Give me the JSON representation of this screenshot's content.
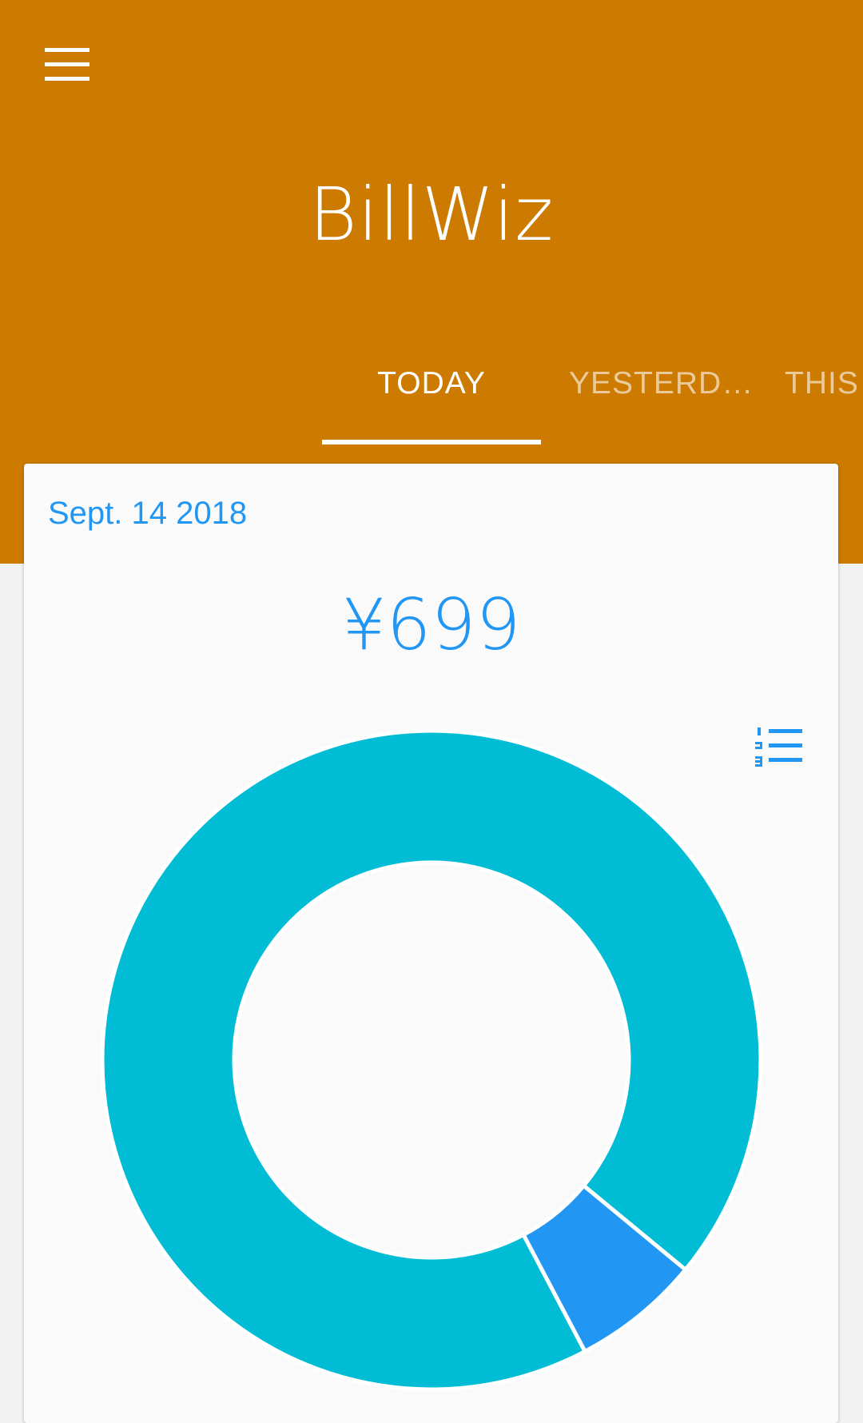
{
  "app": {
    "title": "BillWiz"
  },
  "icons": {
    "menu": "menu-icon",
    "ranking": "numbered-list-icon"
  },
  "tabs": [
    {
      "label": "TODAY",
      "selected": true
    },
    {
      "label": "YESTERD…",
      "selected": false
    },
    {
      "label": "THIS",
      "selected": false
    }
  ],
  "card": {
    "date": "Sept. 14 2018",
    "total": "¥699"
  },
  "colors": {
    "app_bar": "#CC7A00",
    "accent": "#2196F3",
    "segment_main": "#00BCD4",
    "segment_small": "#2196F3"
  },
  "chart_data": {
    "type": "pie",
    "style": "donut",
    "slices": [
      {
        "value": 0.937,
        "color": "#00BCD4"
      },
      {
        "value": 0.063,
        "color": "#2196F3"
      }
    ],
    "start_fraction": 0.1728
  }
}
